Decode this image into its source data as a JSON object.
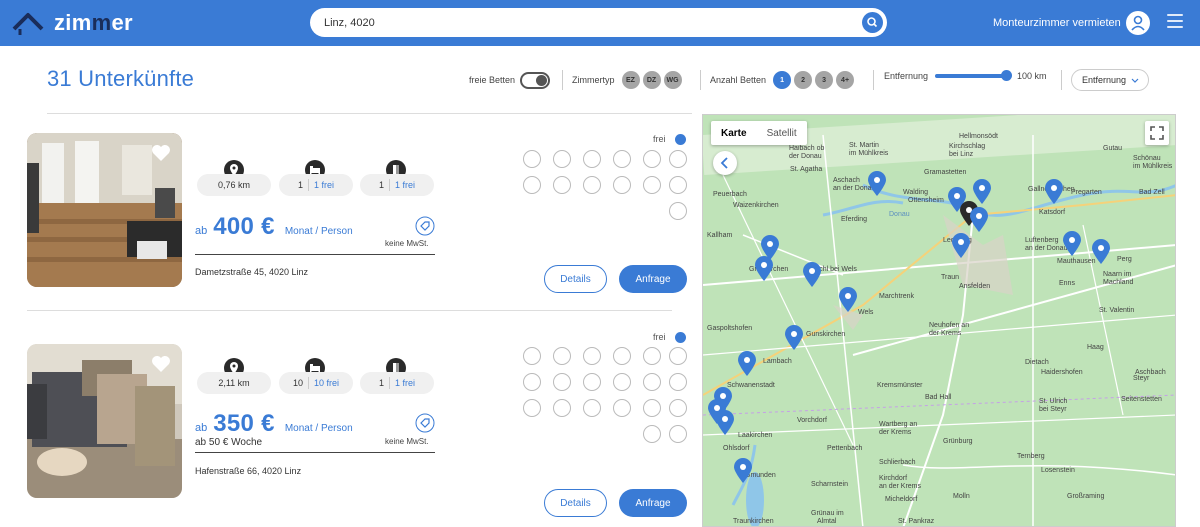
{
  "header": {
    "logo_text_a": "zim",
    "logo_text_b": "m",
    "logo_text_c": "er",
    "search_value": "Linz, 4020",
    "vermieten_label": "Monteurzimmer vermieten"
  },
  "filters": {
    "title": "31 Unterkünfte",
    "freie_betten_label": "freie Betten",
    "zimmertyp_label": "Zimmertyp",
    "zimmertyp_options": [
      "EZ",
      "DZ",
      "WG"
    ],
    "anzahl_betten_label": "Anzahl Betten",
    "anzahl_betten_options": [
      "1",
      "2",
      "3",
      "4+"
    ],
    "anzahl_betten_selected": "1",
    "entfernung_label": "Entfernung",
    "entfernung_value": "100 km",
    "sort_value": "Entfernung"
  },
  "listings": [
    {
      "distance": "0,76 km",
      "beds_total": "1",
      "beds_free": "1 frei",
      "rooms_total": "1",
      "rooms_free": "1 frei",
      "ab": "ab",
      "price": "400 €",
      "unit": "Monat / Person",
      "extra": "",
      "mwst": "keine MwSt.",
      "address": "Dametzstraße 45, 4020 Linz",
      "frei": "frei",
      "details": "Details",
      "anfrage": "Anfrage"
    },
    {
      "distance": "2,11 km",
      "beds_total": "10",
      "beds_free": "10 frei",
      "rooms_total": "1",
      "rooms_free": "1 frei",
      "ab": "ab",
      "price": "350 €",
      "unit": "Monat / Person",
      "extra": "ab 50 € Woche",
      "mwst": "keine MwSt.",
      "address": "Hafenstraße 66, 4020 Linz",
      "frei": "frei",
      "details": "Details",
      "anfrage": "Anfrage"
    }
  ],
  "map": {
    "type_map": "Karte",
    "type_satellite": "Satellit",
    "places": [
      "Hellmonsödt",
      "Haibach ob",
      "der Donau",
      "St. Martin",
      "im Mühlkreis",
      "Kirchschlag",
      "bei Linz",
      "Gutau",
      "St. Agatha",
      "Gramastetten",
      "Schönau",
      "im Mühlkreis",
      "Aschach",
      "an der Donau",
      "Walding",
      "Ottensheim",
      "Gallneukirchen",
      "Pregarten",
      "Bad Zell",
      "Peuerbach",
      "Waizenkirchen",
      "Eferding",
      "Katsdorf",
      "Kallham",
      "Leonding",
      "Luftenberg",
      "an der Donau",
      "Mauthausen",
      "Perg",
      "Grieskirchen",
      "Pichl bei Wels",
      "Traun",
      "Ansfelden",
      "Enns",
      "Naarn im",
      "Machland",
      "Marchtrenk",
      "St. Valentin",
      "Wels",
      "Gaspoltshofen",
      "Gunskirchen",
      "Neuhofen an",
      "der Krems",
      "Haag",
      "Lambach",
      "Dietach",
      "Haidershofen",
      "Schwanenstadt",
      "Kremsmünster",
      "Bad Hall",
      "Aschbach",
      "Seitenstetten",
      "St. Ulrich",
      "bei Steyr",
      "Vorchdorf",
      "Laakirchen",
      "Pettenbach",
      "Wartberg an",
      "der Krems",
      "Grünburg",
      "Ohlsdorf",
      "Gmunden",
      "Scharnstein",
      "Kirchdorf",
      "an der Krems",
      "Ternberg",
      "Losenstein",
      "Micheldorf",
      "Molln",
      "Großraming",
      "Traunkirchen",
      "Grünau im",
      "Almtal",
      "St. Pankraz",
      "Schlierbach",
      "Steyr",
      "Donau"
    ]
  },
  "colors": {
    "brand": "#3a7bd5",
    "map_green": "#bfe3b8",
    "road": "#ffffff"
  }
}
